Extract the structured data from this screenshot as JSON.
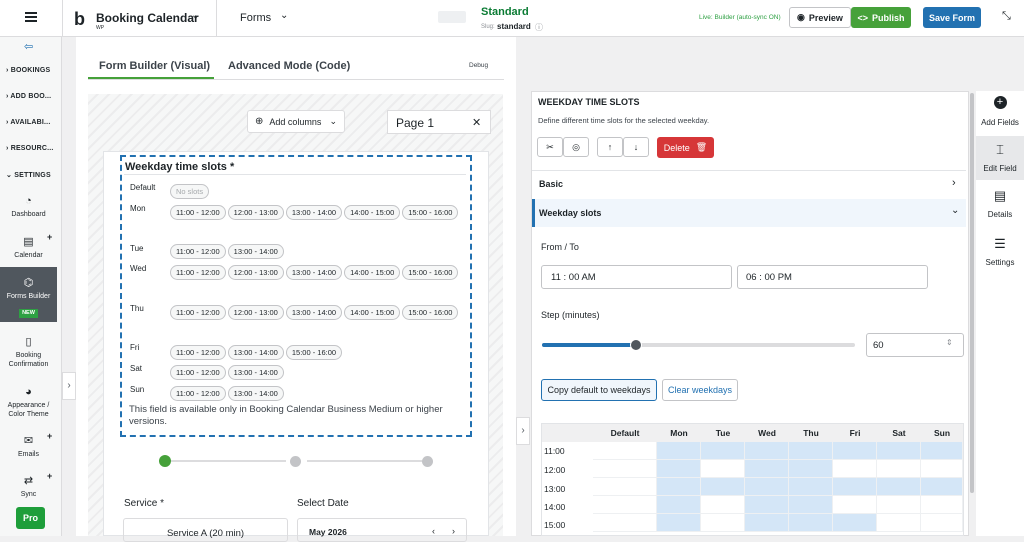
{
  "header": {
    "app_title": "Booking Calendar",
    "app_sub": "WP",
    "forms_menu": "Forms",
    "form_name": "Standard",
    "slug_label": "Slug:",
    "slug_value": "standard",
    "live_status": "Live: Builder (auto-sync ON)",
    "preview": "Preview",
    "publish": "Publish",
    "save_form": "Save Form"
  },
  "sidebar": {
    "sections": [
      "BOOKINGS",
      "ADD BOO...",
      "AVAILABI...",
      "RESOURC...",
      "SETTINGS"
    ],
    "items": [
      "Dashboard",
      "Calendar",
      "Forms Builder",
      "Booking Confirmation",
      "Appearance / Color Theme",
      "Emails",
      "Sync"
    ],
    "new_badge": "NEW",
    "pro": "Pro"
  },
  "tabs": {
    "visual": "Form Builder (Visual)",
    "advanced": "Advanced Mode (Code)",
    "debug": "Debug"
  },
  "canvas": {
    "add_columns": "Add columns",
    "page_label": "Page 1",
    "field_title": "Weekday time slots *",
    "default_label": "Default",
    "no_slots": "No slots",
    "days": [
      {
        "label": "Mon",
        "slots": [
          "11:00 - 12:00",
          "12:00 - 13:00",
          "13:00 - 14:00",
          "14:00 - 15:00",
          "15:00 - 16:00"
        ]
      },
      {
        "label": "Tue",
        "slots": [
          "11:00 - 12:00",
          "13:00 - 14:00"
        ]
      },
      {
        "label": "Wed",
        "slots": [
          "11:00 - 12:00",
          "12:00 - 13:00",
          "13:00 - 14:00",
          "14:00 - 15:00",
          "15:00 - 16:00"
        ]
      },
      {
        "label": "Thu",
        "slots": [
          "11:00 - 12:00",
          "12:00 - 13:00",
          "13:00 - 14:00",
          "14:00 - 15:00",
          "15:00 - 16:00"
        ]
      },
      {
        "label": "Fri",
        "slots": [
          "11:00 - 12:00",
          "13:00 - 14:00",
          "15:00 - 16:00"
        ]
      },
      {
        "label": "Sat",
        "slots": [
          "11:00 - 12:00",
          "13:00 - 14:00"
        ]
      },
      {
        "label": "Sun",
        "slots": [
          "11:00 - 12:00",
          "13:00 - 14:00"
        ]
      }
    ],
    "notice": "This field is available only in Booking Calendar Business Medium or higher versions.",
    "service_label": "Service *",
    "service_value": "Service A (20 min)",
    "date_label": "Select Date",
    "month": "May 2026"
  },
  "panel": {
    "title": "WEEKDAY TIME SLOTS",
    "desc": "Define different time slots for the selected weekday.",
    "delete": "Delete",
    "basic": "Basic",
    "weekday_slots": "Weekday slots",
    "from_to": "From / To",
    "from": "11 : 00   AM",
    "to": "06 : 00   PM",
    "step_label": "Step (minutes)",
    "step_value": "60",
    "step_fraction": 0.5,
    "copy": "Copy default to weekdays",
    "clear": "Clear weekdays",
    "grid_cols": [
      "Default",
      "Mon",
      "Tue",
      "Wed",
      "Thu",
      "Fri",
      "Sat",
      "Sun"
    ],
    "grid_rows": [
      "11:00",
      "12:00",
      "13:00",
      "14:00",
      "15:00"
    ]
  },
  "rail": {
    "add_fields": "Add Fields",
    "edit_field": "Edit Field",
    "details": "Details",
    "settings": "Settings"
  }
}
